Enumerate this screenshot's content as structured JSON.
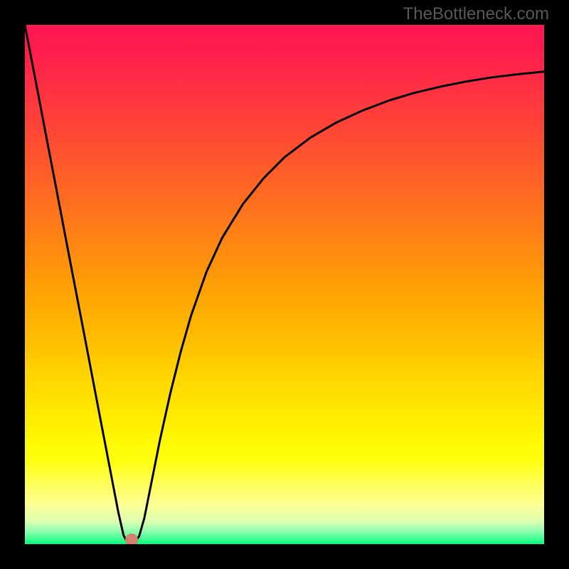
{
  "watermark": "TheBottleneck.com",
  "chart_data": {
    "type": "line",
    "title": "",
    "xlabel": "",
    "ylabel": "",
    "xlim": [
      0,
      100
    ],
    "ylim": [
      0,
      100
    ],
    "grid": false,
    "background_gradient_stops": [
      {
        "offset": 0.0,
        "color": "#ff1850"
      },
      {
        "offset": 0.04,
        "color": "#ff1a4e"
      },
      {
        "offset": 0.1,
        "color": "#ff2b46"
      },
      {
        "offset": 0.2,
        "color": "#ff4536"
      },
      {
        "offset": 0.3,
        "color": "#ff6226"
      },
      {
        "offset": 0.4,
        "color": "#ff8016"
      },
      {
        "offset": 0.5,
        "color": "#ff9e06"
      },
      {
        "offset": 0.58,
        "color": "#ffb600"
      },
      {
        "offset": 0.66,
        "color": "#ffcf00"
      },
      {
        "offset": 0.74,
        "color": "#ffe700"
      },
      {
        "offset": 0.8,
        "color": "#fff800"
      },
      {
        "offset": 0.84,
        "color": "#ffff10"
      },
      {
        "offset": 0.88,
        "color": "#ffff54"
      },
      {
        "offset": 0.92,
        "color": "#ffff90"
      },
      {
        "offset": 0.955,
        "color": "#e0ffb0"
      },
      {
        "offset": 0.975,
        "color": "#90ffb0"
      },
      {
        "offset": 0.99,
        "color": "#40ff90"
      },
      {
        "offset": 1.0,
        "color": "#00ff7a"
      }
    ],
    "series": [
      {
        "name": "bottleneck-curve",
        "color": "#000000",
        "width": 3,
        "x": [
          0,
          2,
          4,
          6,
          8,
          10,
          12,
          14,
          16,
          17,
          18,
          19,
          19.8,
          21,
          22,
          23,
          24,
          26,
          28,
          30,
          32,
          35,
          38,
          42,
          46,
          50,
          55,
          60,
          65,
          70,
          75,
          80,
          85,
          90,
          95,
          100
        ],
        "y": [
          100,
          89.6,
          79.1,
          68.7,
          58.2,
          47.8,
          37.4,
          26.9,
          16.5,
          11.3,
          6.1,
          1.7,
          0.2,
          0.2,
          1.5,
          5.0,
          10.0,
          20.0,
          29.0,
          37.0,
          44.0,
          52.5,
          59.0,
          65.5,
          70.5,
          74.5,
          78.3,
          81.2,
          83.5,
          85.4,
          86.9,
          88.1,
          89.1,
          89.9,
          90.5,
          91.0
        ]
      }
    ],
    "marker": {
      "x": 20.5,
      "y": 0.8,
      "color": "#d88070",
      "radius_px": 9
    }
  }
}
